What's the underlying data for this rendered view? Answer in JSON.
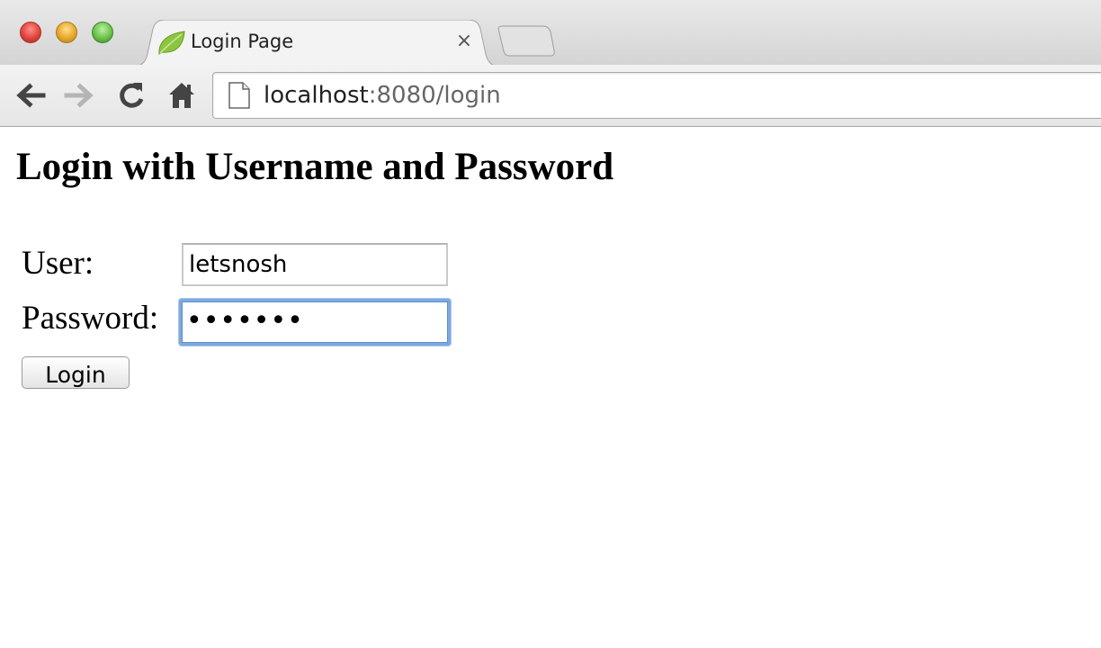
{
  "browser": {
    "tab": {
      "title": "Login Page",
      "favicon": "spring-leaf-icon",
      "close_glyph": "×"
    },
    "toolbar": {
      "url_host": "localhost",
      "url_rest": ":8080/login"
    },
    "colors": {
      "focus_ring": "#7fa9dc",
      "favicon_green": "#8cc63f"
    }
  },
  "page": {
    "heading": "Login with Username and Password",
    "form": {
      "user_label": "User:",
      "user_value": "letsnosh",
      "password_label": "Password:",
      "password_mask": "•••••••",
      "submit_label": "Login"
    }
  }
}
